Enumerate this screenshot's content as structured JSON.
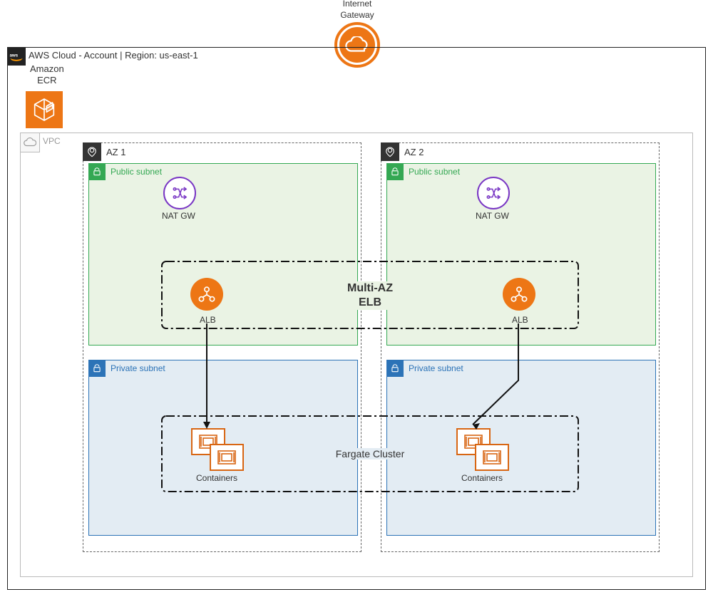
{
  "igw": {
    "label": "Internet\nGateway"
  },
  "cloud": {
    "title": "AWS Cloud - Account | Region: us-east-1"
  },
  "ecr": {
    "label": "Amazon\nECR"
  },
  "vpc": {
    "label": "VPC"
  },
  "az1": {
    "title": "AZ 1",
    "public_subnet": {
      "title": "Public subnet",
      "natgw_label": "NAT GW",
      "alb_label": "ALB"
    },
    "private_subnet": {
      "title": "Private subnet",
      "containers_label": "Containers"
    }
  },
  "az2": {
    "title": "AZ 2",
    "public_subnet": {
      "title": "Public subnet",
      "natgw_label": "NAT GW",
      "alb_label": "ALB"
    },
    "private_subnet": {
      "title": "Private subnet",
      "containers_label": "Containers"
    }
  },
  "elb": {
    "label": "Multi-AZ\nELB"
  },
  "fargate": {
    "label": "Fargate Cluster"
  }
}
